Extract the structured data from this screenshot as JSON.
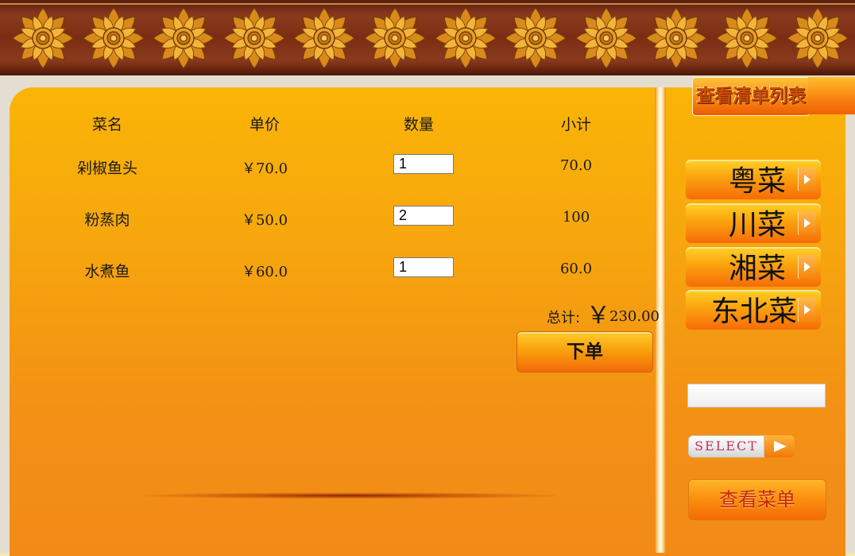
{
  "header": {
    "ornament_icon": "golden-lotus-flower-icon",
    "ornament_count": 12
  },
  "table": {
    "headers": {
      "name": "菜名",
      "price": "单价",
      "quantity": "数量",
      "subtotal": "小计"
    },
    "rows": [
      {
        "name": "剁椒鱼头",
        "price": "￥70.0",
        "quantity": "1",
        "subtotal": "70.0"
      },
      {
        "name": "粉蒸肉",
        "price": "￥50.0",
        "quantity": "2",
        "subtotal": "100"
      },
      {
        "name": "水煮鱼",
        "price": "￥60.0",
        "quantity": "1",
        "subtotal": "60.0"
      }
    ]
  },
  "total": {
    "label": "总计:",
    "currency": "￥",
    "value": "230.00"
  },
  "order_button": "下单",
  "sidebar": {
    "view_list_button": "查看清单列表",
    "categories": [
      {
        "label": "粤菜"
      },
      {
        "label": "川菜"
      },
      {
        "label": "湘菜"
      },
      {
        "label": "东北菜"
      }
    ],
    "search_value": "",
    "select_button": "SELECT",
    "view_menu_button": "查看菜单"
  },
  "colors": {
    "panel_top": "#fab406",
    "panel_bottom": "#f28a18",
    "header_wood": "#7b2c14",
    "frame": "#e4ddd1"
  }
}
